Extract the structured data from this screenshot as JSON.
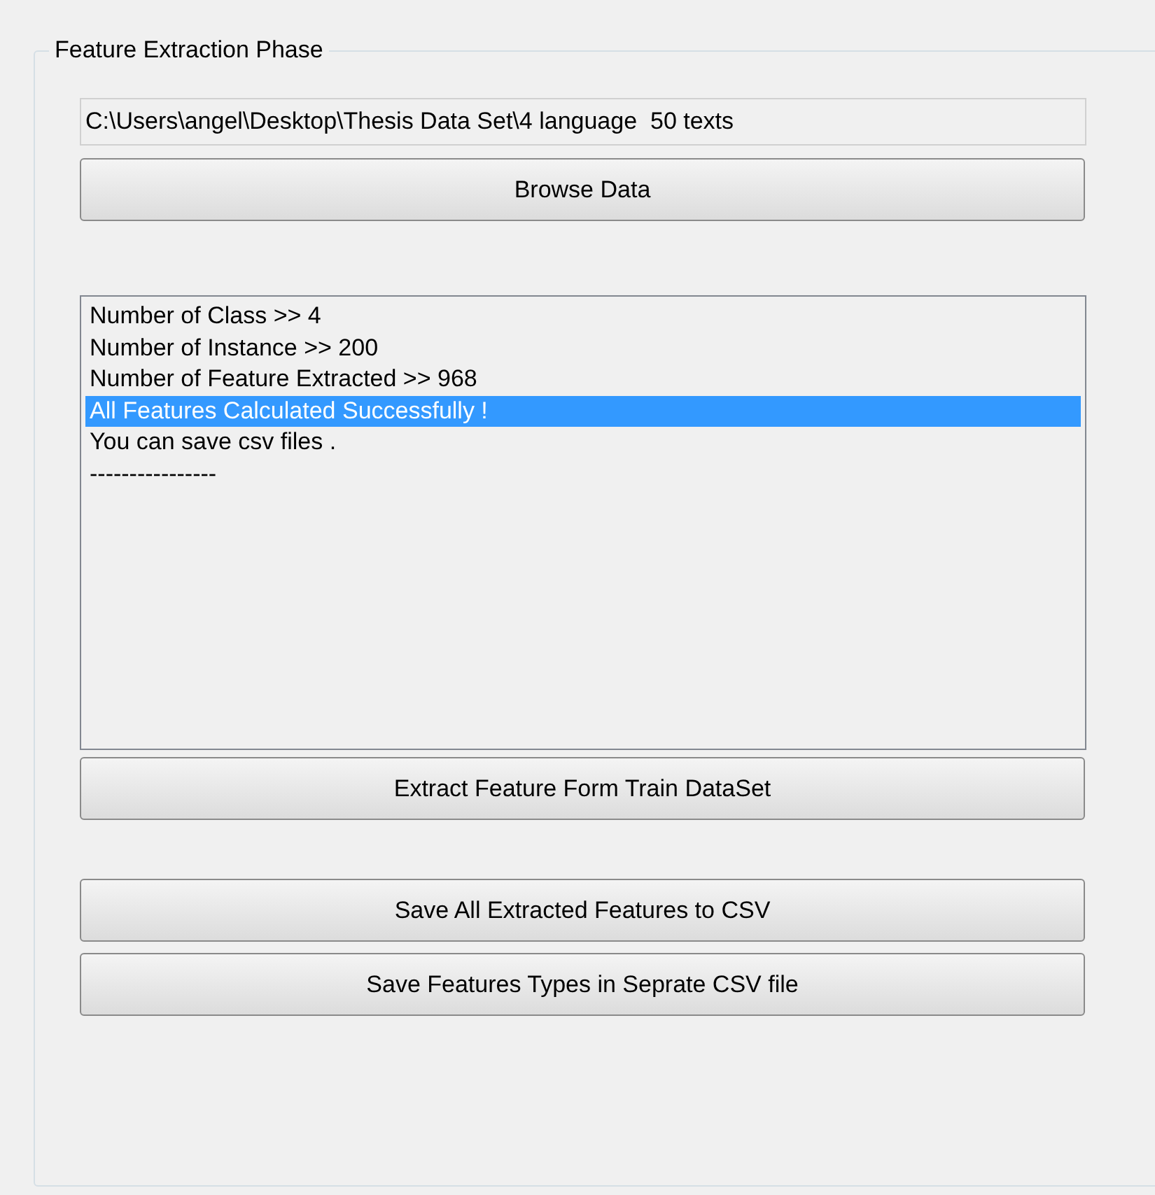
{
  "group": {
    "title": "Feature Extraction Phase"
  },
  "path_field": {
    "value": "C:\\Users\\angel\\Desktop\\Thesis Data Set\\4 language  50 texts"
  },
  "browse_button": "Browse Data",
  "log_list": [
    {
      "text": "Number of Class >> 4",
      "selected": false
    },
    {
      "text": "Number of Instance >> 200",
      "selected": false
    },
    {
      "text": "Number of Feature Extracted >> 968",
      "selected": false
    },
    {
      "text": "All Features Calculated Successfully !",
      "selected": true
    },
    {
      "text": "You can save csv files .",
      "selected": false
    },
    {
      "text": "----------------",
      "selected": false
    }
  ],
  "extract_button": "Extract Feature Form Train DataSet",
  "save_buttons": [
    "Save All Extracted Features to CSV",
    "Save Features Types in Seprate CSV file"
  ]
}
